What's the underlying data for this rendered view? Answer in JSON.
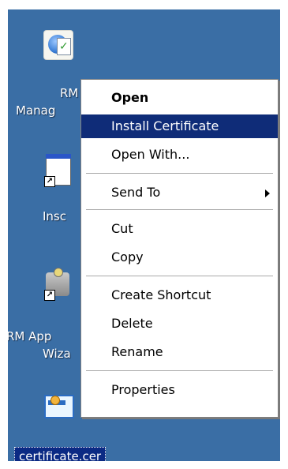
{
  "desktop": {
    "icons": [
      {
        "name": "RM Manager",
        "visible_label_line1": "RM",
        "visible_label_line2": "Manag"
      },
      {
        "name": "Ins",
        "visible_label": "Insc"
      },
      {
        "name": "RM App Wizard",
        "visible_label_line1": "RM App",
        "visible_label_line2": "Wiza"
      },
      {
        "name": "certificate.cer",
        "visible_label": "certificate.cer"
      }
    ]
  },
  "context_menu": {
    "items": [
      {
        "label": "Open",
        "bold": true
      },
      {
        "label": "Install Certificate",
        "highlight": true
      },
      {
        "label": "Open With..."
      },
      {
        "label": "Send To",
        "has_submenu": true
      },
      {
        "label": "Cut"
      },
      {
        "label": "Copy"
      },
      {
        "label": "Create Shortcut"
      },
      {
        "label": "Delete"
      },
      {
        "label": "Rename"
      },
      {
        "label": "Properties"
      }
    ]
  }
}
